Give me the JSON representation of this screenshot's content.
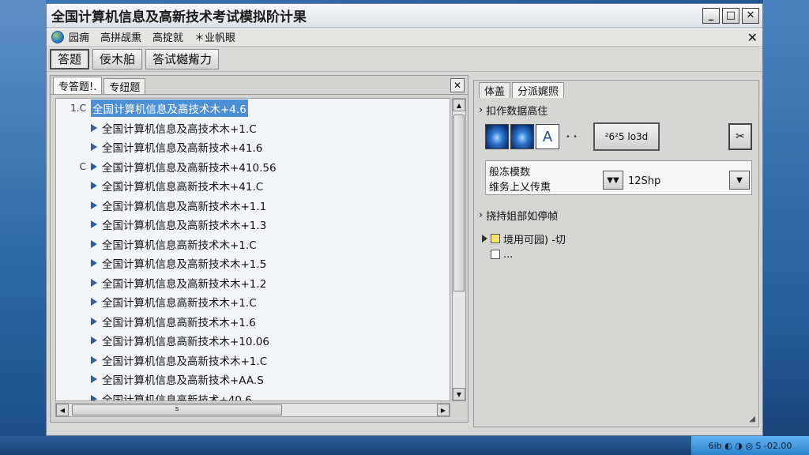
{
  "window": {
    "title": "全国计算机信息及高新技术考试模拟阶计果"
  },
  "menu": {
    "items": [
      "园痈",
      "高拼觇熏",
      "高掟就",
      "＊业帆眼"
    ]
  },
  "toolbar": {
    "buttons": [
      "答题",
      "佞木舶",
      "答试樾觜力"
    ]
  },
  "left_panel": {
    "tabs": [
      "专答题!.",
      "专纽题"
    ],
    "rows": [
      {
        "prefix": "1.C",
        "text": "全国计算机信息及高技术木+4.6",
        "selected": true
      },
      {
        "prefix": "",
        "text": "全国计算机信息及高技术木+1.C",
        "selected": false
      },
      {
        "prefix": "",
        "text": "全国计算机信息及高新技术+41.6",
        "selected": false
      },
      {
        "prefix": "C",
        "text": "全国计算机信息及高新技术+410.56",
        "selected": false
      },
      {
        "prefix": "",
        "text": "全国计算机信息高新技术木+41.C",
        "selected": false
      },
      {
        "prefix": "",
        "text": "全国计算机信息及高新技术木+1.1",
        "selected": false
      },
      {
        "prefix": "",
        "text": "全国计算机信息及高新技术木+1.3",
        "selected": false
      },
      {
        "prefix": "",
        "text": "全国计算机信息高新技术木+1.C",
        "selected": false
      },
      {
        "prefix": "",
        "text": "全国计算机信息及高新技术木+1.5",
        "selected": false
      },
      {
        "prefix": "",
        "text": "全国计算机信息及高新技术木+1.2",
        "selected": false
      },
      {
        "prefix": "",
        "text": "全国计算机信息高新技术木+1.C",
        "selected": false
      },
      {
        "prefix": "",
        "text": "全国计算机信息高新技术木+1.6",
        "selected": false
      },
      {
        "prefix": "",
        "text": "全国计算机信息高新技术木+10.06",
        "selected": false
      },
      {
        "prefix": "",
        "text": "全国计算机信息及高新技术木+1.C",
        "selected": false
      },
      {
        "prefix": "",
        "text": "全国计算机信息及高新技术+AA.S",
        "selected": false
      },
      {
        "prefix": "",
        "text": "全国计算机信息高新技术+40.6",
        "selected": false
      }
    ],
    "hscroll_label": "s"
  },
  "right_panel": {
    "tabs": [
      "体盖",
      "分派娓照"
    ],
    "section1": "扣作数据高住",
    "icon_a": "A",
    "big_button": "²6²5 lo3d",
    "tool_button": "✂",
    "form": {
      "line1": "般冻模数",
      "line2": "维务上乂传熏",
      "value": "12Shp"
    },
    "section2": "挠持姐部如停帧",
    "tree": [
      {
        "label": "境用可园) -切",
        "checked": true
      },
      {
        "label": "...",
        "checked": false
      }
    ]
  },
  "tray": {
    "text": "6ib ◐ ◑ ◎ S -02.00"
  },
  "colors": {
    "selection": "#4d8fd6",
    "desktop": "#1d4f8a"
  }
}
